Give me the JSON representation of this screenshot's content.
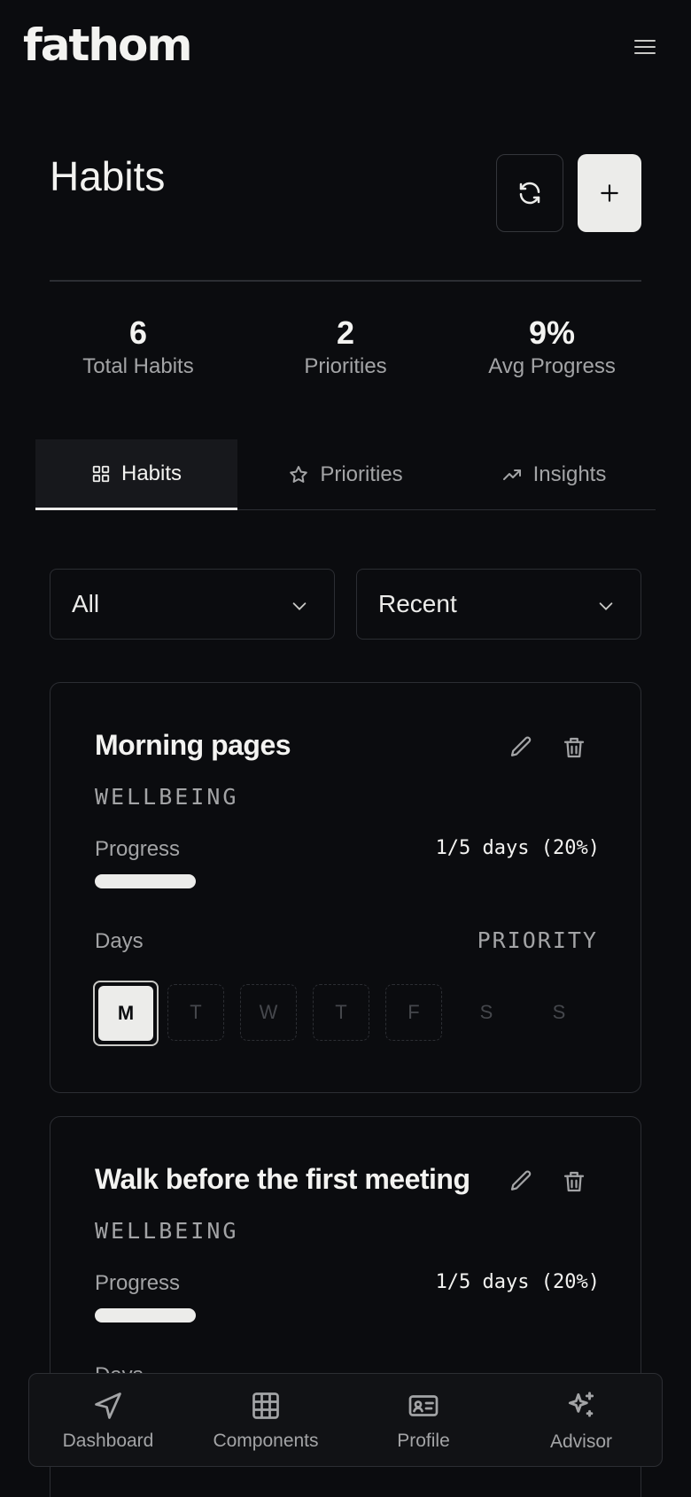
{
  "app": {
    "logo": "fathom"
  },
  "header": {
    "title": "Habits"
  },
  "stats": [
    {
      "value": "6",
      "label": "Total Habits"
    },
    {
      "value": "2",
      "label": "Priorities"
    },
    {
      "value": "9%",
      "label": "Avg Progress"
    }
  ],
  "tabs": [
    {
      "label": "Habits",
      "icon": "grid-icon",
      "active": true
    },
    {
      "label": "Priorities",
      "icon": "star-icon",
      "active": false
    },
    {
      "label": "Insights",
      "icon": "trending-up-icon",
      "active": false
    }
  ],
  "filters": {
    "category": "All",
    "sort": "Recent"
  },
  "habits": [
    {
      "name": "Morning pages",
      "category": "WELLBEING",
      "progress_label": "Progress",
      "progress_text": "1/5 days (20%)",
      "progress_fraction": 0.2,
      "days_label": "Days",
      "priority_label": "PRIORITY",
      "days": [
        "M",
        "T",
        "W",
        "T",
        "F",
        "S",
        "S"
      ]
    },
    {
      "name": "Walk before the first meeting",
      "category": "WELLBEING",
      "progress_label": "Progress",
      "progress_text": "1/5 days (20%)",
      "progress_fraction": 0.2,
      "days_label": "Days"
    }
  ],
  "bottom_nav": [
    {
      "label": "Dashboard",
      "icon": "navigation-icon"
    },
    {
      "label": "Components",
      "icon": "grid-table-icon"
    },
    {
      "label": "Profile",
      "icon": "id-card-icon"
    },
    {
      "label": "Advisor",
      "icon": "sparkles-icon"
    }
  ],
  "colors": {
    "background": "#0b0c0f",
    "accent": "#ececea",
    "muted": "#a3a4a6",
    "border": "#2c2e33"
  }
}
